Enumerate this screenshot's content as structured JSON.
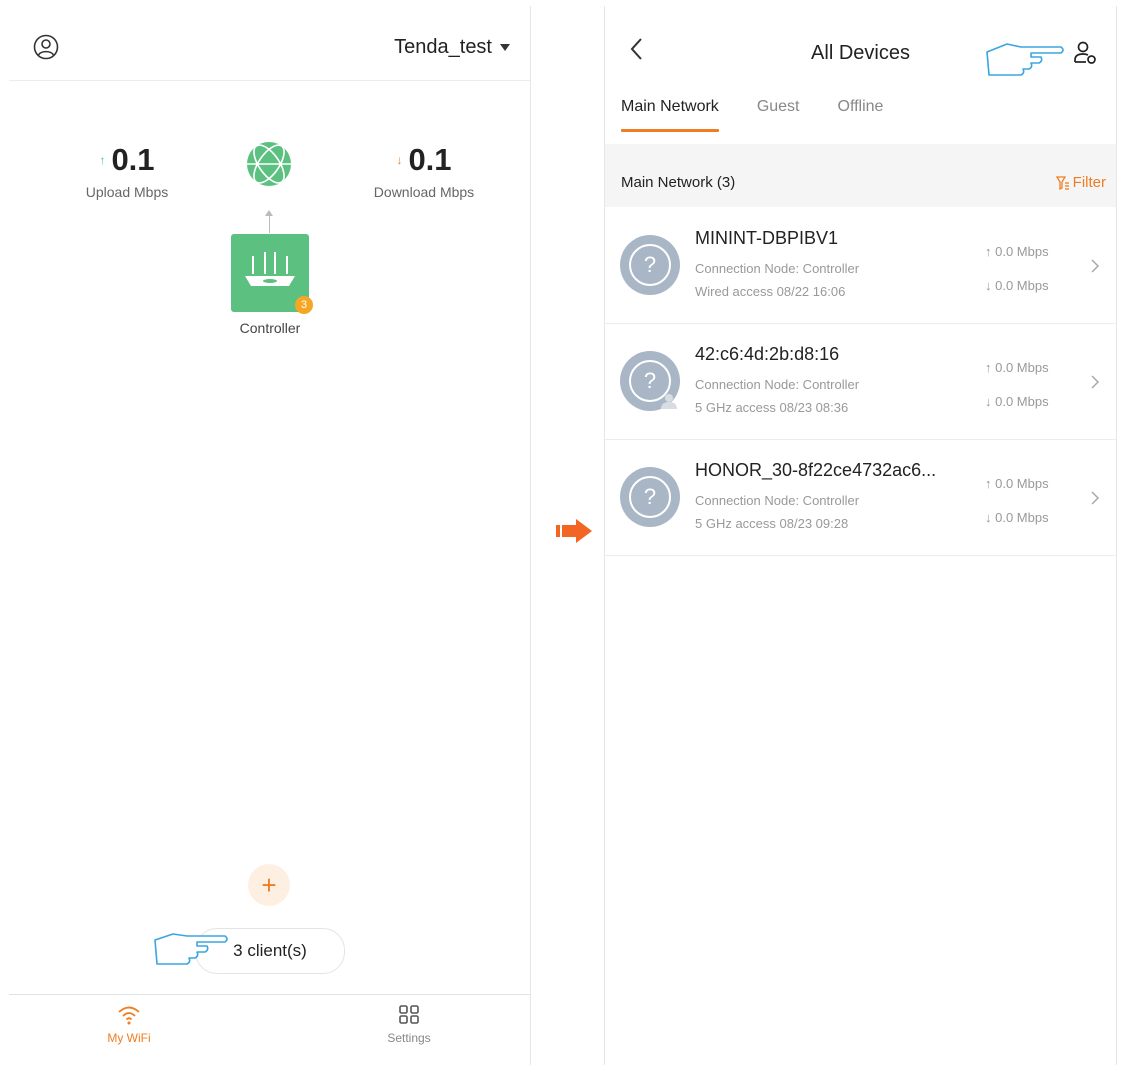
{
  "left": {
    "header": {
      "network_name": "Tenda_test"
    },
    "upload": {
      "value": "0.1",
      "label": "Upload Mbps"
    },
    "download": {
      "value": "0.1",
      "label": "Download Mbps"
    },
    "node": {
      "label": "Controller",
      "badge": "3"
    },
    "add_label": "+",
    "clients_label": "3 client(s)",
    "tabbar": {
      "mywifi_label": "My WiFi",
      "settings_label": "Settings"
    }
  },
  "right": {
    "header": {
      "title": "All Devices"
    },
    "tabs": [
      {
        "label": "Main Network"
      },
      {
        "label": "Guest"
      },
      {
        "label": "Offline"
      }
    ],
    "section": {
      "title": "Main Network (3)",
      "filter_label": "Filter"
    },
    "devices": [
      {
        "name": "MININT-DBPIBV1",
        "node": "Connection Node: Controller",
        "access": "Wired access   08/22 16:06",
        "up": "0.0 Mbps",
        "down": "0.0 Mbps"
      },
      {
        "name": "42:c6:4d:2b:d8:16",
        "node": "Connection Node: Controller",
        "access": "5 GHz access   08/23 08:36",
        "up": "0.0 Mbps",
        "down": "0.0 Mbps"
      },
      {
        "name": "HONOR_30-8f22ce4732ac6...",
        "node": "Connection Node: Controller",
        "access": "5 GHz access   08/23 09:28",
        "up": "0.0 Mbps",
        "down": "0.0 Mbps"
      }
    ]
  },
  "colors": {
    "accent": "#ef7d22",
    "router_green": "#5cc081",
    "avatar_gray": "#a9b6c6",
    "hand_blue": "#3aa5e0"
  }
}
